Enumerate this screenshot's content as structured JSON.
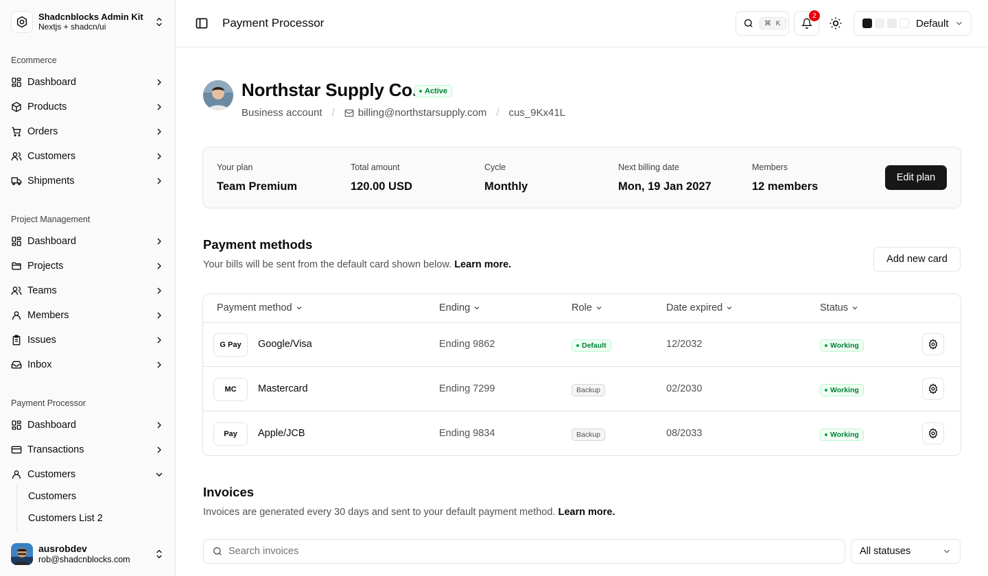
{
  "brand": {
    "title": "Shadcnblocks Admin Kit",
    "subtitle": "Nextjs + shadcn/ui",
    "icon": "hexagon-logo-icon"
  },
  "sidebar": {
    "groups": [
      {
        "label": "Ecommerce",
        "items": [
          {
            "label": "Dashboard",
            "icon": "dashboard-icon"
          },
          {
            "label": "Products",
            "icon": "package-icon"
          },
          {
            "label": "Orders",
            "icon": "cart-icon"
          },
          {
            "label": "Customers",
            "icon": "users-icon"
          },
          {
            "label": "Shipments",
            "icon": "truck-icon"
          }
        ]
      },
      {
        "label": "Project Management",
        "items": [
          {
            "label": "Dashboard",
            "icon": "dashboard-icon"
          },
          {
            "label": "Projects",
            "icon": "folder-icon"
          },
          {
            "label": "Teams",
            "icon": "users-icon"
          },
          {
            "label": "Members",
            "icon": "user-icon"
          },
          {
            "label": "Issues",
            "icon": "clipboard-icon"
          },
          {
            "label": "Inbox",
            "icon": "inbox-icon"
          }
        ]
      },
      {
        "label": "Payment Processor",
        "items": [
          {
            "label": "Dashboard",
            "icon": "dashboard-icon"
          },
          {
            "label": "Transactions",
            "icon": "credit-card-icon"
          },
          {
            "label": "Customers",
            "icon": "user-icon",
            "expanded": true
          }
        ]
      }
    ],
    "sub_items": [
      "Customers",
      "Customers List 2"
    ]
  },
  "user": {
    "name": "ausrobdev",
    "email": "rob@shadcnblocks.com"
  },
  "header": {
    "title": "Payment Processor",
    "search_kbd": "⌘ K",
    "notifications": "2",
    "theme": "Default",
    "swatches": [
      "#171717",
      "#f0f0f0",
      "#ececec",
      "#ffffff"
    ]
  },
  "profile": {
    "name": "Northstar Supply Co.",
    "status": "Active",
    "account_type": "Business account",
    "email": "billing@northstarsupply.com",
    "customer_id": "cus_9Kx41L"
  },
  "plan": {
    "fields": [
      {
        "label": "Your plan",
        "value": "Team Premium"
      },
      {
        "label": "Total amount",
        "value": "120.00 USD"
      },
      {
        "label": "Cycle",
        "value": "Monthly"
      },
      {
        "label": "Next billing date",
        "value": "Mon, 19 Jan 2027"
      },
      {
        "label": "Members",
        "value": "12 members"
      }
    ],
    "edit_label": "Edit plan"
  },
  "payment_methods": {
    "title": "Payment methods",
    "description": "Your bills will be sent from the default card shown below.",
    "learn_more": "Learn more.",
    "add_label": "Add new card",
    "columns": [
      "Payment method",
      "Ending",
      "Role",
      "Date expired",
      "Status"
    ],
    "rows": [
      {
        "logo": "G Pay",
        "name": "Google/Visa",
        "ending": "Ending 9862",
        "role": "Default",
        "expired": "12/2032",
        "status": "Working"
      },
      {
        "logo": "MC",
        "name": "Mastercard",
        "ending": "Ending 7299",
        "role": "Backup",
        "expired": "02/2030",
        "status": "Working"
      },
      {
        "logo": "Pay",
        "name": "Apple/JCB",
        "ending": "Ending 9834",
        "role": "Backup",
        "expired": "08/2033",
        "status": "Working"
      }
    ]
  },
  "invoices": {
    "title": "Invoices",
    "description": "Invoices are generated every 30 days and sent to your default payment method.",
    "learn_more": "Learn more.",
    "search_placeholder": "Search invoices",
    "status_filter": "All statuses"
  },
  "colors": {
    "accent": "#171717",
    "success": "#00a63e",
    "danger": "#e7000b",
    "border": "#e5e5e5"
  }
}
